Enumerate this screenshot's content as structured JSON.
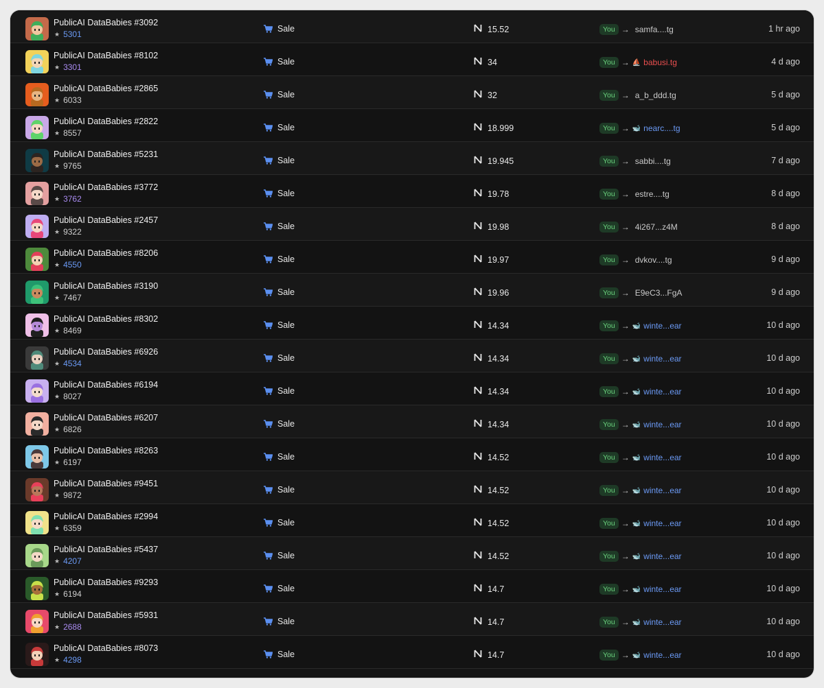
{
  "activity": {
    "rows": [
      {
        "name": "PublicAI DataBabies #3092",
        "rank": "5301",
        "rank_style": "blue",
        "event": "Sale",
        "price": "15.52",
        "from": "You",
        "to": "samfa....tg",
        "to_style": "plain",
        "to_icon": "",
        "time": "1 hr ago",
        "bg": "#c46a4a",
        "hair": "#3fae5b",
        "face": "#f0c7a0"
      },
      {
        "name": "PublicAI DataBabies #8102",
        "rank": "3301",
        "rank_style": "purple",
        "event": "Sale",
        "price": "34",
        "from": "You",
        "to": "babusi.tg",
        "to_style": "red",
        "to_icon": "⛵",
        "time": "4 d ago",
        "bg": "#f2d25a",
        "hair": "#7fd6e0",
        "face": "#f3d6b8"
      },
      {
        "name": "PublicAI DataBabies #2865",
        "rank": "6033",
        "rank_style": "plain",
        "event": "Sale",
        "price": "32",
        "from": "You",
        "to": "a_b_ddd.tg",
        "to_style": "plain",
        "to_icon": "",
        "time": "5 d ago",
        "bg": "#e65d1e",
        "hair": "#b86a20",
        "face": "#e7b583"
      },
      {
        "name": "PublicAI DataBabies #2822",
        "rank": "8557",
        "rank_style": "plain",
        "event": "Sale",
        "price": "18.999",
        "from": "You",
        "to": "nearc....tg",
        "to_style": "blue",
        "to_icon": "🐋",
        "time": "5 d ago",
        "bg": "#c9a8e8",
        "hair": "#5fd36a",
        "face": "#f6d8c4"
      },
      {
        "name": "PublicAI DataBabies #5231",
        "rank": "9765",
        "rank_style": "plain",
        "event": "Sale",
        "price": "19.945",
        "from": "You",
        "to": "sabbi....tg",
        "to_style": "plain",
        "to_icon": "",
        "time": "7 d ago",
        "bg": "#0f3b45",
        "hair": "#2c2420",
        "face": "#9a6a45"
      },
      {
        "name": "PublicAI DataBabies #3772",
        "rank": "3762",
        "rank_style": "purple",
        "event": "Sale",
        "price": "19.78",
        "from": "You",
        "to": "estre....tg",
        "to_style": "plain",
        "to_icon": "",
        "time": "8 d ago",
        "bg": "#e4a0a0",
        "hair": "#5a4a48",
        "face": "#f4d9c8"
      },
      {
        "name": "PublicAI DataBabies #2457",
        "rank": "9322",
        "rank_style": "plain",
        "event": "Sale",
        "price": "19.98",
        "from": "You",
        "to": "4i267...z4M",
        "to_style": "plain",
        "to_icon": "",
        "time": "8 d ago",
        "bg": "#bfaef2",
        "hair": "#e8487a",
        "face": "#f6d8c4"
      },
      {
        "name": "PublicAI DataBabies #8206",
        "rank": "4550",
        "rank_style": "blue",
        "event": "Sale",
        "price": "19.97",
        "from": "You",
        "to": "dvkov....tg",
        "to_style": "plain",
        "to_icon": "",
        "time": "9 d ago",
        "bg": "#4e8a3c",
        "hair": "#e2405a",
        "face": "#f3d0b2"
      },
      {
        "name": "PublicAI DataBabies #3190",
        "rank": "7467",
        "rank_style": "plain",
        "event": "Sale",
        "price": "19.96",
        "from": "You",
        "to": "E9eC3...FgA",
        "to_style": "plain",
        "to_icon": "",
        "time": "9 d ago",
        "bg": "#1f9a6a",
        "hair": "#3dc27a",
        "face": "#c98a5e"
      },
      {
        "name": "PublicAI DataBabies #8302",
        "rank": "8469",
        "rank_style": "plain",
        "event": "Sale",
        "price": "14.34",
        "from": "You",
        "to": "winte...ear",
        "to_style": "blue",
        "to_icon": "🐋",
        "time": "10 d ago",
        "bg": "#f0c0e8",
        "hair": "#1f1f1f",
        "face": "#b58ad8"
      },
      {
        "name": "PublicAI DataBabies #6926",
        "rank": "4534",
        "rank_style": "blue",
        "event": "Sale",
        "price": "14.34",
        "from": "You",
        "to": "winte...ear",
        "to_style": "blue",
        "to_icon": "🐋",
        "time": "10 d ago",
        "bg": "#3a3a3a",
        "hair": "#4f8a7a",
        "face": "#e8d0c0"
      },
      {
        "name": "PublicAI DataBabies #6194",
        "rank": "8027",
        "rank_style": "plain",
        "event": "Sale",
        "price": "14.34",
        "from": "You",
        "to": "winte...ear",
        "to_style": "blue",
        "to_icon": "🐋",
        "time": "10 d ago",
        "bg": "#c8b0f0",
        "hair": "#9a70e0",
        "face": "#f3dccb"
      },
      {
        "name": "PublicAI DataBabies #6207",
        "rank": "6826",
        "rank_style": "plain",
        "event": "Sale",
        "price": "14.34",
        "from": "You",
        "to": "winte...ear",
        "to_style": "blue",
        "to_icon": "🐋",
        "time": "10 d ago",
        "bg": "#f2b0a0",
        "hair": "#2a2a2a",
        "face": "#f3d8c6"
      },
      {
        "name": "PublicAI DataBabies #8263",
        "rank": "6197",
        "rank_style": "plain",
        "event": "Sale",
        "price": "14.52",
        "from": "You",
        "to": "winte...ear",
        "to_style": "blue",
        "to_icon": "🐋",
        "time": "10 d ago",
        "bg": "#7ec8e8",
        "hair": "#4a3a3a",
        "face": "#e8c0a8"
      },
      {
        "name": "PublicAI DataBabies #9451",
        "rank": "9872",
        "rank_style": "plain",
        "event": "Sale",
        "price": "14.52",
        "from": "You",
        "to": "winte...ear",
        "to_style": "blue",
        "to_icon": "🐋",
        "time": "10 d ago",
        "bg": "#6a3a2a",
        "hair": "#e8405a",
        "face": "#b8785a"
      },
      {
        "name": "PublicAI DataBabies #2994",
        "rank": "6359",
        "rank_style": "plain",
        "event": "Sale",
        "price": "14.52",
        "from": "You",
        "to": "winte...ear",
        "to_style": "blue",
        "to_icon": "🐋",
        "time": "10 d ago",
        "bg": "#f0e28a",
        "hair": "#7fe0b0",
        "face": "#f6dcc8"
      },
      {
        "name": "PublicAI DataBabies #5437",
        "rank": "4207",
        "rank_style": "blue",
        "event": "Sale",
        "price": "14.52",
        "from": "You",
        "to": "winte...ear",
        "to_style": "blue",
        "to_icon": "🐋",
        "time": "10 d ago",
        "bg": "#a8d88a",
        "hair": "#6a9a5a",
        "face": "#f3d8c6"
      },
      {
        "name": "PublicAI DataBabies #9293",
        "rank": "6194",
        "rank_style": "plain",
        "event": "Sale",
        "price": "14.7",
        "from": "You",
        "to": "winte...ear",
        "to_style": "blue",
        "to_icon": "🐋",
        "time": "10 d ago",
        "bg": "#2a5a2a",
        "hair": "#c8e04a",
        "face": "#a8703a"
      },
      {
        "name": "PublicAI DataBabies #5931",
        "rank": "2688",
        "rank_style": "purple",
        "event": "Sale",
        "price": "14.7",
        "from": "You",
        "to": "winte...ear",
        "to_style": "blue",
        "to_icon": "🐋",
        "time": "10 d ago",
        "bg": "#e84a6a",
        "hair": "#f0a030",
        "face": "#f6d8c4"
      },
      {
        "name": "PublicAI DataBabies #8073",
        "rank": "4298",
        "rank_style": "blue",
        "event": "Sale",
        "price": "14.7",
        "from": "You",
        "to": "winte...ear",
        "to_style": "blue",
        "to_icon": "🐋",
        "time": "10 d ago",
        "bg": "#2a1a1a",
        "hair": "#c83a3a",
        "face": "#f3d0b8"
      }
    ]
  }
}
